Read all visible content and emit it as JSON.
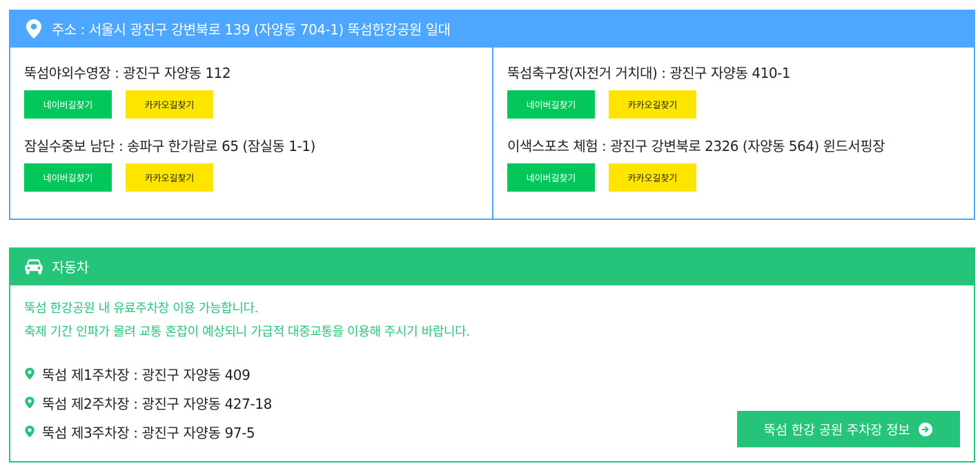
{
  "address_card": {
    "header_icon": "location-pin-icon",
    "header_text": "주소 : 서울시 광진구 강변북로 139 (자양동 704-1) 뚝섬한강공원 일대",
    "left": [
      {
        "title": "뚝섬야외수영장 : 광진구 자양동 112",
        "naver": "네이버길찾기",
        "kakao": "카카오길찾기"
      },
      {
        "title": "잠실수중보 남단 : 송파구 한가람로 65 (잠실동 1-1)",
        "naver": "네이버길찾기",
        "kakao": "카카오길찾기"
      }
    ],
    "right": [
      {
        "title": "뚝섬축구장(자전거 거치대) : 광진구 자양동 410-1",
        "naver": "네이버길찾기",
        "kakao": "카카오길찾기"
      },
      {
        "title": "이색스포츠 체험 : 광진구 강변북로 2326 (자양동 564) 윈드서핑장",
        "naver": "네이버길찾기",
        "kakao": "카카오길찾기"
      }
    ]
  },
  "car_card": {
    "header_icon": "car-icon",
    "header_text": "자동차",
    "notice_line1": "뚝섬 한강공원 내 유료주차장 이용 가능합니다.",
    "notice_line2": "축제 기간 인파가 몰려 교통 혼잡이 예상되니 가급적 대중교통을 이용해 주시기 바랍니다.",
    "parking": [
      "뚝섬 제1주차장 : 광진구 자양동 409",
      "뚝섬 제2주차장 : 광진구 자양동 427-18",
      "뚝섬 제3주차장 : 광진구 자양동 97-5"
    ],
    "parking_button": "뚝섬 한강 공원 주차장 정보",
    "parking_button_icon": "arrow-right-circle-icon"
  },
  "colors": {
    "blue": "#4da6ff",
    "green": "#26c47a",
    "naver": "#03c75a",
    "kakao": "#fee500"
  }
}
